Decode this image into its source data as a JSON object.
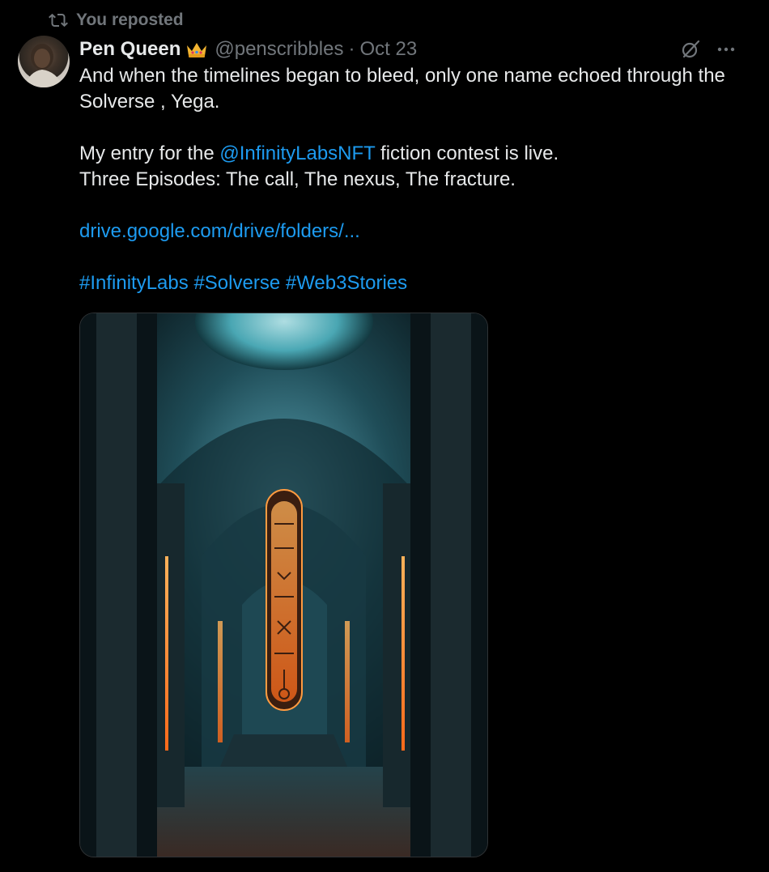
{
  "repost": {
    "label": "You reposted"
  },
  "author": {
    "name": "Pen Queen",
    "handle": "@penscribbles",
    "separator": "·",
    "date": "Oct 23"
  },
  "tweet": {
    "line1": "And when the timelines began to bleed, only one name echoed through the",
    "line2": "Solverse , Yega.",
    "line3_pre": "My entry for the ",
    "line3_mention": "@InfinityLabsNFT",
    "line3_post": " fiction contest is live.",
    "line4": "Three Episodes: The call, The nexus, The fracture.",
    "link": "drive.google.com/drive/folders/...",
    "hashtags": [
      "#InfinityLabs",
      "#Solverse",
      "#Web3Stories"
    ]
  },
  "icons": {
    "repost": "repost-icon",
    "grok": "grok-icon",
    "more": "more-icon",
    "crown": "crown-emoji-icon"
  },
  "colors": {
    "background": "#000000",
    "text": "#e7e9ea",
    "muted": "#71767b",
    "link": "#1d9bf0"
  }
}
